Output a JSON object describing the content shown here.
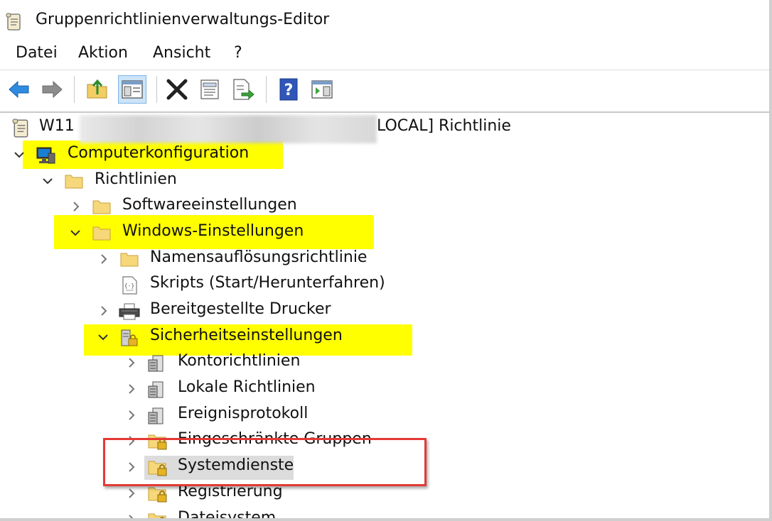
{
  "window": {
    "title": "Gruppenrichtlinienverwaltungs-Editor"
  },
  "menu": [
    "Datei",
    "Aktion",
    "Ansicht",
    "?"
  ],
  "toolbar": {
    "buttons": [
      "back-icon",
      "forward-icon",
      "up-folder-icon",
      "show-hide-tree-icon",
      "delete-icon",
      "properties-icon",
      "export-list-icon",
      "help-icon",
      "action-pane-icon"
    ]
  },
  "tree": {
    "root_prefix": "W11",
    "root_suffix": "LOCAL] Richtlinie",
    "items": [
      {
        "label": "Computerkonfiguration",
        "state": "expanded",
        "highlight": true,
        "icon": "computer-icon"
      },
      {
        "label": "Richtlinien",
        "state": "expanded",
        "icon": "folder-icon"
      },
      {
        "label": "Softwareeinstellungen",
        "state": "collapsed",
        "icon": "folder-icon"
      },
      {
        "label": "Windows-Einstellungen",
        "state": "expanded",
        "highlight": true,
        "icon": "folder-icon"
      },
      {
        "label": "Namensauflösungsrichtlinie",
        "state": "collapsed",
        "icon": "folder-icon"
      },
      {
        "label": "Skripts (Start/Herunterfahren)",
        "state": "none",
        "icon": "script-icon"
      },
      {
        "label": "Bereitgestellte Drucker",
        "state": "collapsed",
        "icon": "printer-icon"
      },
      {
        "label": "Sicherheitseinstellungen",
        "state": "expanded",
        "highlight": true,
        "icon": "security-settings-icon"
      },
      {
        "label": "Kontorichtlinien",
        "state": "collapsed",
        "icon": "policy-icon"
      },
      {
        "label": "Lokale Richtlinien",
        "state": "collapsed",
        "icon": "policy-icon"
      },
      {
        "label": "Ereignisprotokoll",
        "state": "collapsed",
        "icon": "policy-icon"
      },
      {
        "label": "Eingeschränkte Gruppen",
        "state": "collapsed",
        "icon": "locked-folder-icon"
      },
      {
        "label": "Systemdienste",
        "state": "collapsed",
        "selected": true,
        "icon": "locked-folder-icon"
      },
      {
        "label": "Registrierung",
        "state": "collapsed",
        "icon": "locked-folder-icon"
      },
      {
        "label": "Dateisystem",
        "state": "collapsed",
        "icon": "locked-folder-icon"
      }
    ]
  },
  "colors": {
    "highlight": "#ffff00",
    "annotation_box": "#e53935",
    "selection": "#dcdcdc"
  }
}
